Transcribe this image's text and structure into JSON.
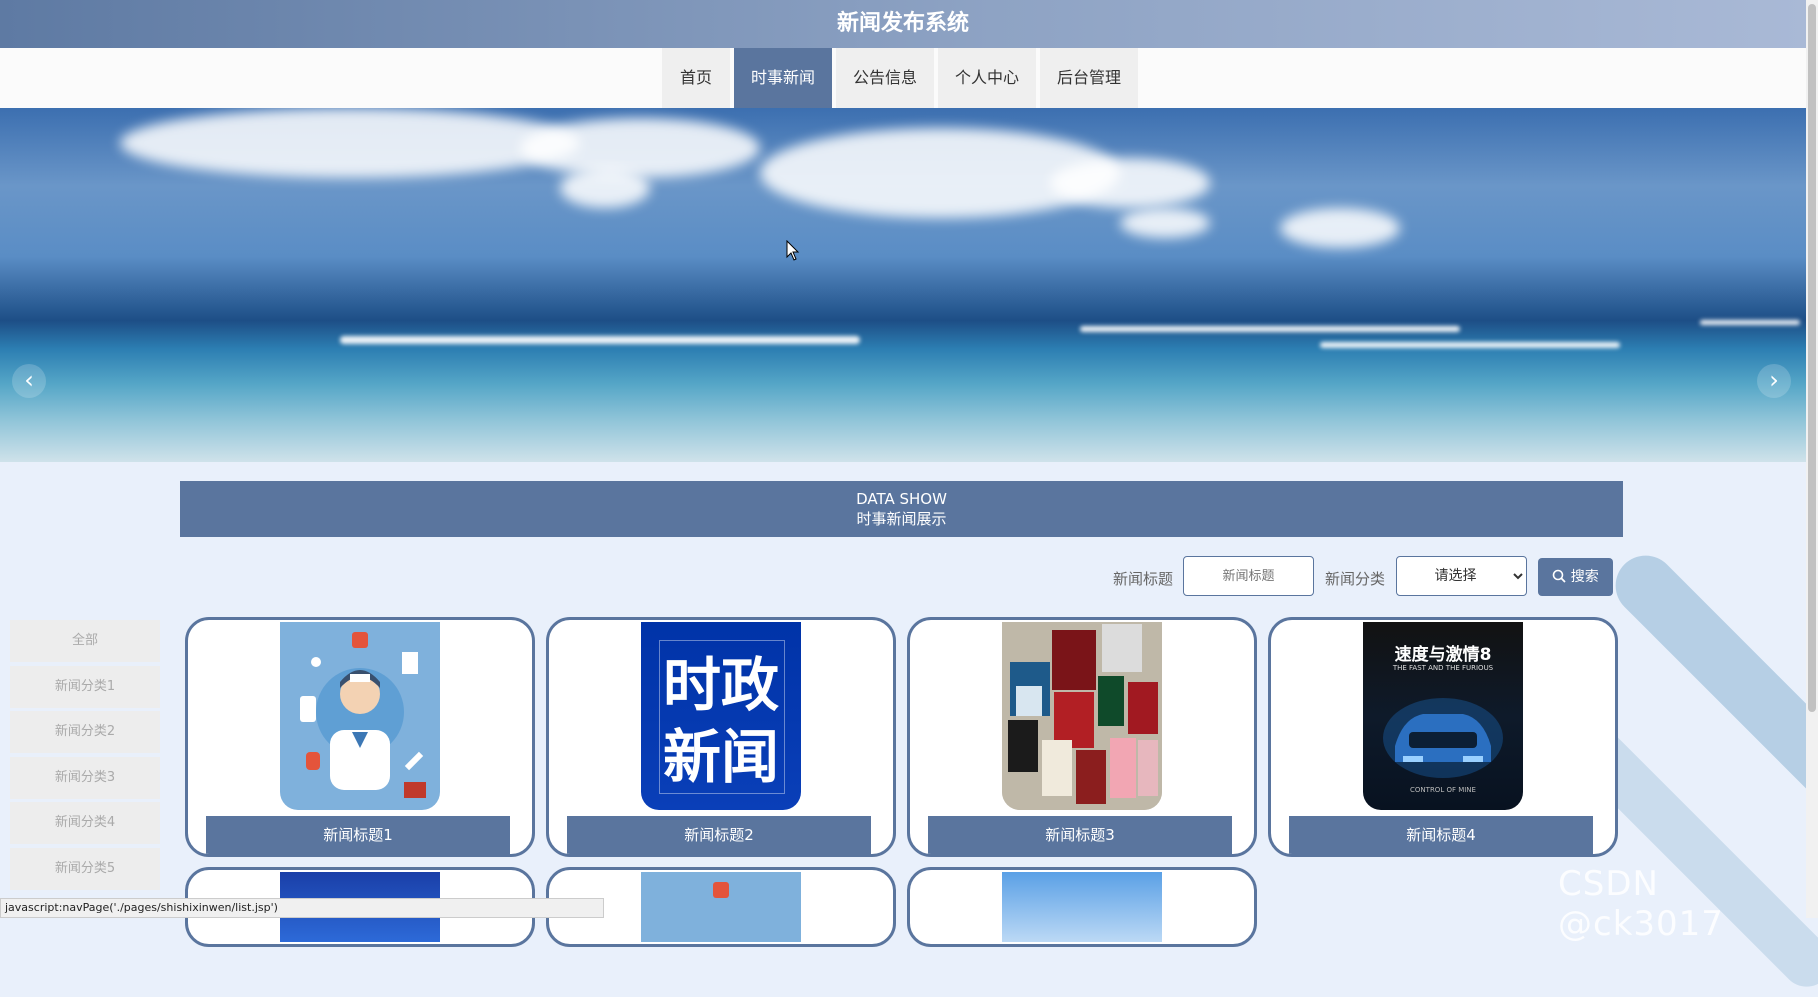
{
  "header": {
    "title": "新闻发布系统"
  },
  "nav": {
    "items": [
      {
        "label": "首页"
      },
      {
        "label": "时事新闻"
      },
      {
        "label": "公告信息"
      },
      {
        "label": "个人中心"
      },
      {
        "label": "后台管理"
      }
    ],
    "active_index": 1
  },
  "banner": {
    "prev_icon": "chevron-left-icon",
    "next_icon": "chevron-right-icon"
  },
  "section": {
    "title_en": "DATA SHOW",
    "title_cn": "时事新闻展示"
  },
  "search": {
    "title_label": "新闻标题",
    "title_placeholder": "新闻标题",
    "category_label": "新闻分类",
    "category_selected": "请选择",
    "button_label": "搜索",
    "button_icon": "search-icon"
  },
  "categories": [
    "全部",
    "新闻分类1",
    "新闻分类2",
    "新闻分类3",
    "新闻分类4",
    "新闻分类5"
  ],
  "cards": [
    {
      "title": "新闻标题1"
    },
    {
      "title": "新闻标题2"
    },
    {
      "title": "新闻标题3"
    },
    {
      "title": "新闻标题4"
    }
  ],
  "card_images": {
    "img2_line1": "时政",
    "img2_line2": "新闻",
    "img4_line1": "速度与激情8",
    "img4_line2": "THE FAST AND THE FURIOUS",
    "img4_line3": "CONTROL OF MINE"
  },
  "watermark": "CSDN @ck3017",
  "status_bar": "javascript:navPage('./pages/shishixinwen/list.jsp')",
  "colors": {
    "accent": "#5a759e",
    "page_bg": "#e9f0fb"
  }
}
